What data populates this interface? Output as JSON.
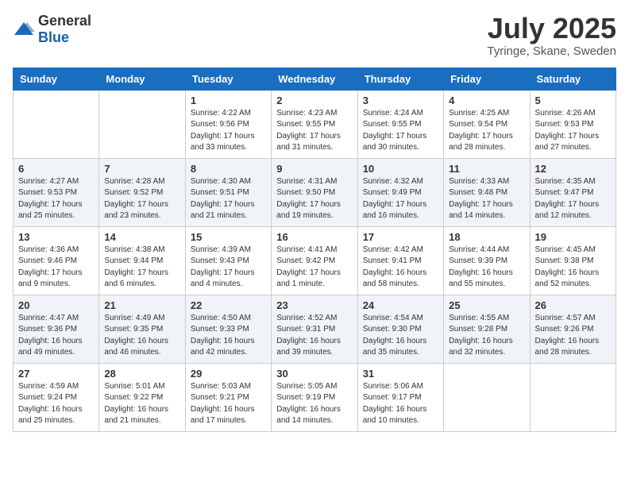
{
  "header": {
    "logo_general": "General",
    "logo_blue": "Blue",
    "month_title": "July 2025",
    "location": "Tyringe, Skane, Sweden"
  },
  "weekdays": [
    "Sunday",
    "Monday",
    "Tuesday",
    "Wednesday",
    "Thursday",
    "Friday",
    "Saturday"
  ],
  "weeks": [
    [
      {
        "day": "",
        "info": ""
      },
      {
        "day": "",
        "info": ""
      },
      {
        "day": "1",
        "info": "Sunrise: 4:22 AM\nSunset: 9:56 PM\nDaylight: 17 hours and 33 minutes."
      },
      {
        "day": "2",
        "info": "Sunrise: 4:23 AM\nSunset: 9:55 PM\nDaylight: 17 hours and 31 minutes."
      },
      {
        "day": "3",
        "info": "Sunrise: 4:24 AM\nSunset: 9:55 PM\nDaylight: 17 hours and 30 minutes."
      },
      {
        "day": "4",
        "info": "Sunrise: 4:25 AM\nSunset: 9:54 PM\nDaylight: 17 hours and 28 minutes."
      },
      {
        "day": "5",
        "info": "Sunrise: 4:26 AM\nSunset: 9:53 PM\nDaylight: 17 hours and 27 minutes."
      }
    ],
    [
      {
        "day": "6",
        "info": "Sunrise: 4:27 AM\nSunset: 9:53 PM\nDaylight: 17 hours and 25 minutes."
      },
      {
        "day": "7",
        "info": "Sunrise: 4:28 AM\nSunset: 9:52 PM\nDaylight: 17 hours and 23 minutes."
      },
      {
        "day": "8",
        "info": "Sunrise: 4:30 AM\nSunset: 9:51 PM\nDaylight: 17 hours and 21 minutes."
      },
      {
        "day": "9",
        "info": "Sunrise: 4:31 AM\nSunset: 9:50 PM\nDaylight: 17 hours and 19 minutes."
      },
      {
        "day": "10",
        "info": "Sunrise: 4:32 AM\nSunset: 9:49 PM\nDaylight: 17 hours and 16 minutes."
      },
      {
        "day": "11",
        "info": "Sunrise: 4:33 AM\nSunset: 9:48 PM\nDaylight: 17 hours and 14 minutes."
      },
      {
        "day": "12",
        "info": "Sunrise: 4:35 AM\nSunset: 9:47 PM\nDaylight: 17 hours and 12 minutes."
      }
    ],
    [
      {
        "day": "13",
        "info": "Sunrise: 4:36 AM\nSunset: 9:46 PM\nDaylight: 17 hours and 9 minutes."
      },
      {
        "day": "14",
        "info": "Sunrise: 4:38 AM\nSunset: 9:44 PM\nDaylight: 17 hours and 6 minutes."
      },
      {
        "day": "15",
        "info": "Sunrise: 4:39 AM\nSunset: 9:43 PM\nDaylight: 17 hours and 4 minutes."
      },
      {
        "day": "16",
        "info": "Sunrise: 4:41 AM\nSunset: 9:42 PM\nDaylight: 17 hours and 1 minute."
      },
      {
        "day": "17",
        "info": "Sunrise: 4:42 AM\nSunset: 9:41 PM\nDaylight: 16 hours and 58 minutes."
      },
      {
        "day": "18",
        "info": "Sunrise: 4:44 AM\nSunset: 9:39 PM\nDaylight: 16 hours and 55 minutes."
      },
      {
        "day": "19",
        "info": "Sunrise: 4:45 AM\nSunset: 9:38 PM\nDaylight: 16 hours and 52 minutes."
      }
    ],
    [
      {
        "day": "20",
        "info": "Sunrise: 4:47 AM\nSunset: 9:36 PM\nDaylight: 16 hours and 49 minutes."
      },
      {
        "day": "21",
        "info": "Sunrise: 4:49 AM\nSunset: 9:35 PM\nDaylight: 16 hours and 46 minutes."
      },
      {
        "day": "22",
        "info": "Sunrise: 4:50 AM\nSunset: 9:33 PM\nDaylight: 16 hours and 42 minutes."
      },
      {
        "day": "23",
        "info": "Sunrise: 4:52 AM\nSunset: 9:31 PM\nDaylight: 16 hours and 39 minutes."
      },
      {
        "day": "24",
        "info": "Sunrise: 4:54 AM\nSunset: 9:30 PM\nDaylight: 16 hours and 35 minutes."
      },
      {
        "day": "25",
        "info": "Sunrise: 4:55 AM\nSunset: 9:28 PM\nDaylight: 16 hours and 32 minutes."
      },
      {
        "day": "26",
        "info": "Sunrise: 4:57 AM\nSunset: 9:26 PM\nDaylight: 16 hours and 28 minutes."
      }
    ],
    [
      {
        "day": "27",
        "info": "Sunrise: 4:59 AM\nSunset: 9:24 PM\nDaylight: 16 hours and 25 minutes."
      },
      {
        "day": "28",
        "info": "Sunrise: 5:01 AM\nSunset: 9:22 PM\nDaylight: 16 hours and 21 minutes."
      },
      {
        "day": "29",
        "info": "Sunrise: 5:03 AM\nSunset: 9:21 PM\nDaylight: 16 hours and 17 minutes."
      },
      {
        "day": "30",
        "info": "Sunrise: 5:05 AM\nSunset: 9:19 PM\nDaylight: 16 hours and 14 minutes."
      },
      {
        "day": "31",
        "info": "Sunrise: 5:06 AM\nSunset: 9:17 PM\nDaylight: 16 hours and 10 minutes."
      },
      {
        "day": "",
        "info": ""
      },
      {
        "day": "",
        "info": ""
      }
    ]
  ]
}
